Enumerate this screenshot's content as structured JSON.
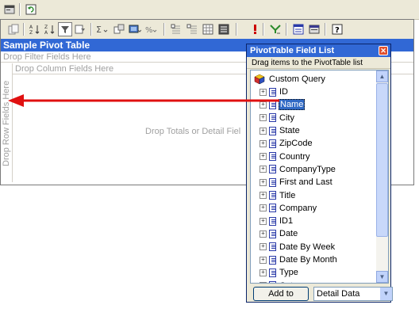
{
  "app": {
    "pivot_title": "Sample Pivot Table",
    "filter_zone": "Drop Filter Fields Here",
    "column_zone": "Drop Column Fields Here",
    "row_zone": "Drop Row Fields Here",
    "data_zone": "Drop Totals or Detail Fiel"
  },
  "toolbar": {
    "icons": [
      "properties-icon",
      "refresh-icon",
      "copy-icon",
      "sort-ascending-icon",
      "sort-descending-icon",
      "autofilter-icon",
      "show-top-bottom-icon",
      "autocalc-icon",
      "subtotal-icon",
      "calculated-totals-icon",
      "show-as-icon",
      "collapse-icon",
      "expand-icon",
      "hide-details-icon",
      "show-details-icon",
      "refresh-data-icon",
      "export-icon",
      "field-list-icon",
      "commands-options-icon",
      "help-icon"
    ]
  },
  "field_list": {
    "title": "PivotTable Field List",
    "hint": "Drag items to the PivotTable list",
    "root": "Custom Query",
    "fields": [
      "ID",
      "Name",
      "City",
      "State",
      "ZipCode",
      "Country",
      "CompanyType",
      "First and Last",
      "Title",
      "Company",
      "ID1",
      "Date",
      "Date By Week",
      "Date By Month",
      "Type",
      "Category"
    ],
    "selected_field": "Name",
    "add_button": "Add to",
    "area_select": "Detail Data"
  },
  "colors": {
    "title_blue": "#3168d5",
    "arrow_red": "#e01010",
    "selection_blue": "#316ac5"
  }
}
